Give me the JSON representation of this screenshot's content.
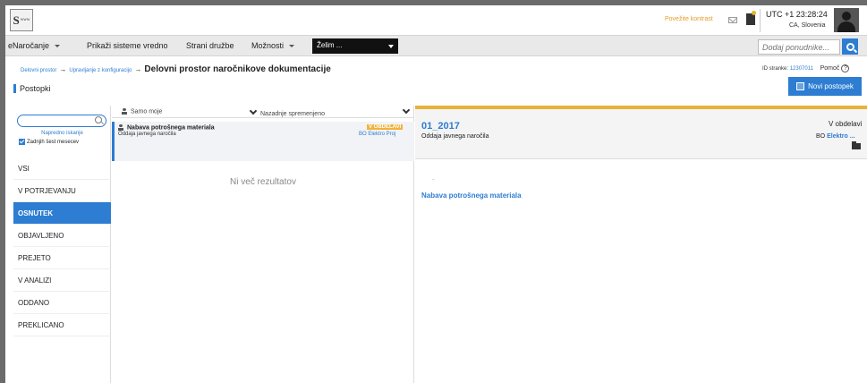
{
  "header": {
    "logo_text": "S",
    "logo_small": "www",
    "contact_link": "Povežite kontrast",
    "time": "UTC +1 23:28:24",
    "location": "CA, Slovenia"
  },
  "nav": {
    "items": [
      "eNaročanje",
      "Prikaži sisteme vredno",
      "Strani družbe",
      "Možnosti"
    ],
    "work_select": "Želim ...",
    "search_placeholder": "Dodaj ponudnike..."
  },
  "breadcrumb": {
    "crumb1": "Delovni prostor",
    "crumb2": "Upravljanje z konfiguracijo",
    "title": "Delovni prostor naročnikove dokumentacije"
  },
  "right_info": {
    "id_label": "ID stranke:",
    "id_value": "12307011",
    "help_label": "Pomoč"
  },
  "section_title": "Postopki",
  "new_button": "Novi postopek",
  "sidebar": {
    "advanced_search": "Napredno iskanje",
    "last_months": "Zadnjih šest mesecev",
    "items": [
      "VSI",
      "V POTRJEVANJU",
      "OSNUTEK",
      "OBJAVLJENO",
      "PREJETO",
      "V ANALIZI",
      "ODDANO",
      "PREKLICANO"
    ],
    "active_index": 2
  },
  "list": {
    "filter_own": "Samo moje",
    "filter_changed": "Nazadnje spremenjeno",
    "row": {
      "title": "Nabava potrošnega materiala",
      "subtitle": "Oddaja javnega naročila",
      "status": "V OBDELAVI",
      "org": "BO Elektro Proj"
    },
    "no_results": "Ni več rezultatov"
  },
  "detail": {
    "title": "01_2017",
    "subtitle": "Oddaja javnega naročila",
    "status": "V obdelavi",
    "org_prefix": "BO",
    "org_link": "Elektro ...",
    "dash": "-",
    "link": "Nabava potrošnega materiala"
  },
  "colors": {
    "accent": "#2d7dd2",
    "status": "#f0b33c",
    "header_border": "#e6b23a"
  }
}
